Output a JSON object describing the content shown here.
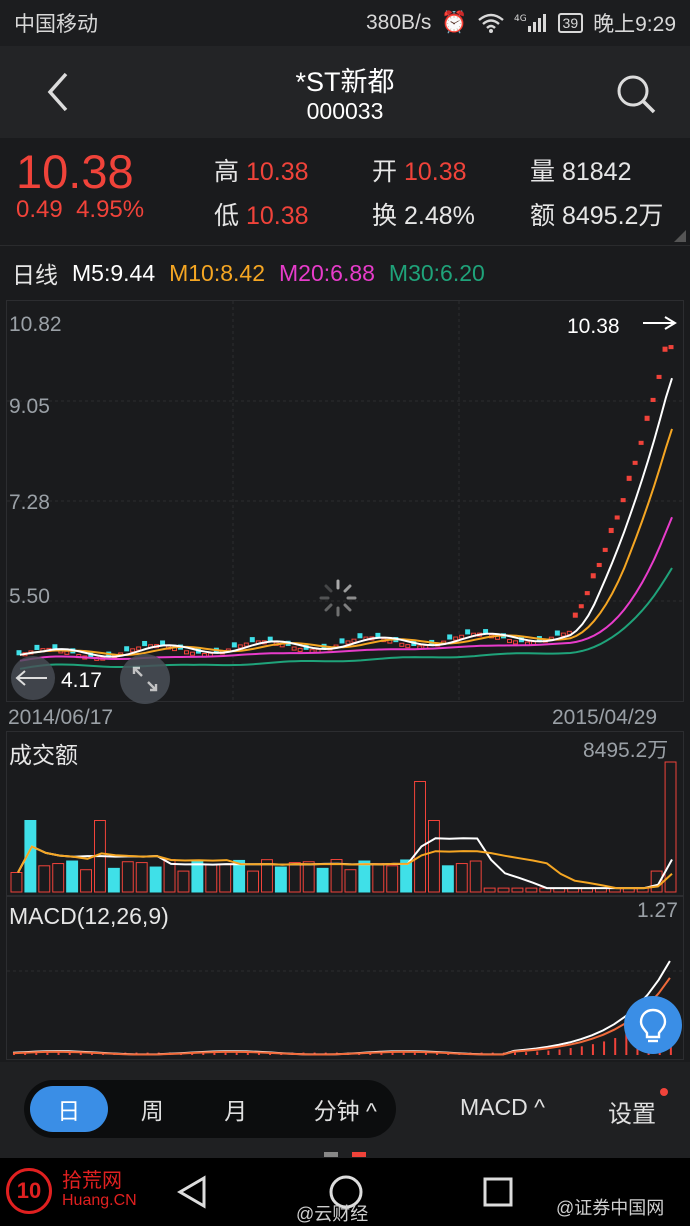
{
  "status": {
    "carrier": "中国移动",
    "speed": "380B/s",
    "battery": "39",
    "time": "晚上9:29",
    "network": "4G"
  },
  "header": {
    "name": "*ST新都",
    "code": "000033"
  },
  "quote": {
    "price": "10.38",
    "change": "0.49",
    "change_pct": "4.95%",
    "high_label": "高",
    "high": "10.38",
    "low_label": "低",
    "low": "10.38",
    "open_label": "开",
    "open": "10.38",
    "turnover_label": "换",
    "turnover": "2.48%",
    "volume_label": "量",
    "volume": "81842",
    "amount_label": "额",
    "amount": "8495.2万"
  },
  "ma": {
    "period": "日线",
    "m5": "M5:9.44",
    "m10": "M10:8.42",
    "m20": "M20:6.88",
    "m30": "M30:6.20"
  },
  "colors": {
    "up": "#f0433a",
    "down": "#3fe0e8",
    "m5": "#ffffff",
    "m10": "#f5a623",
    "m20": "#e83ccb",
    "m30": "#1fa37a",
    "accent": "#3a8ee6"
  },
  "kline": {
    "y_labels": [
      "10.82",
      "9.05",
      "7.28",
      "5.50"
    ],
    "start_date": "2014/06/17",
    "end_date": "2015/04/29",
    "last_price": "10.38",
    "low_price": "4.17"
  },
  "volume_panel": {
    "title": "成交额",
    "max": "8495.2万"
  },
  "macd_panel": {
    "title": "MACD(12,26,9)",
    "max": "1.27"
  },
  "tabs": {
    "day": "日",
    "week": "周",
    "month": "月",
    "minute": "分钟 ^",
    "indicator": "MACD ^",
    "settings": "设置"
  },
  "watermarks": {
    "site": "拾荒网",
    "site_domain": "Huang.CN",
    "weibo1": "@云财经",
    "weibo2": "@证券中国网"
  }
}
